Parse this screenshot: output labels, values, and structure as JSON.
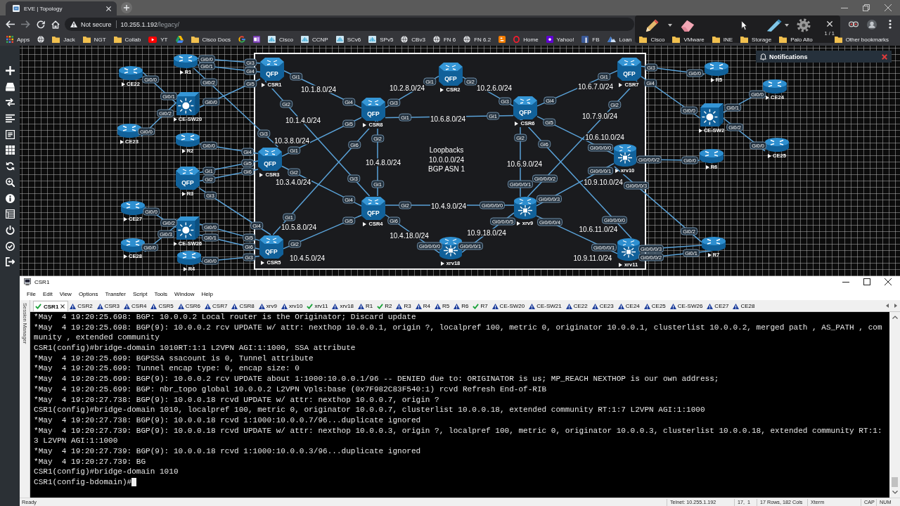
{
  "browser": {
    "tabs": [
      {
        "title": "EVE | Topology",
        "selected": true
      }
    ],
    "address": {
      "security": "Not secure",
      "host": "10.255.1.192",
      "path": "/legacy/"
    },
    "bookmarks": [
      {
        "kind": "apps",
        "label": "Apps"
      },
      {
        "kind": "globe"
      },
      {
        "kind": "folder",
        "label": "Jack"
      },
      {
        "kind": "folder",
        "label": "NGT"
      },
      {
        "kind": "folder",
        "label": "Collab"
      },
      {
        "kind": "video",
        "label": "YT"
      },
      {
        "kind": "drive"
      },
      {
        "kind": "folder",
        "label": "Cisco Docs"
      },
      {
        "kind": "ring"
      },
      {
        "kind": "note"
      },
      {
        "kind": "bars",
        "label": "Cisco"
      },
      {
        "kind": "bars",
        "label": "CCNP"
      },
      {
        "kind": "bars",
        "label": "SCv6"
      },
      {
        "kind": "bars",
        "label": "SPv5"
      },
      {
        "kind": "globe",
        "label": "CBv3"
      },
      {
        "kind": "globe",
        "label": "FN 6"
      },
      {
        "kind": "globe",
        "label": "FN 6.2"
      },
      {
        "kind": "blog"
      },
      {
        "kind": "oval",
        "label": "Home"
      },
      {
        "kind": "square_p",
        "label": "Yahoo!"
      },
      {
        "kind": "square_b",
        "label": "FB"
      },
      {
        "kind": "mountain",
        "label": "Loan"
      },
      {
        "kind": "folder",
        "label": "Cisco"
      },
      {
        "kind": "folder",
        "label": "VMware"
      },
      {
        "kind": "folder",
        "label": "INE"
      },
      {
        "kind": "folder",
        "label": "Storage"
      },
      {
        "kind": "folder",
        "label": "Palo Alto"
      }
    ],
    "other_bookmarks": "Other bookmarks",
    "annotation_toolbar": {
      "page": "1 / 1"
    }
  },
  "topology": {
    "nodes": [
      {
        "name": "CE22",
        "kind": "router",
        "running": true
      },
      {
        "name": "R1",
        "kind": "router",
        "running": true
      },
      {
        "name": "CE-SW20",
        "kind": "switch",
        "running": true
      },
      {
        "name": "CE23",
        "kind": "router",
        "running": true
      },
      {
        "name": "R2",
        "kind": "router",
        "running": true
      },
      {
        "name": "R3",
        "kind": "qfp",
        "badge": "QFP",
        "running": true
      },
      {
        "name": "CE27",
        "kind": "router",
        "running": true
      },
      {
        "name": "CE-SW26",
        "kind": "switch",
        "running": true
      },
      {
        "name": "CE28",
        "kind": "router",
        "running": true
      },
      {
        "name": "R4",
        "kind": "router",
        "running": true
      },
      {
        "name": "CSR1",
        "kind": "qfp",
        "badge": "QFP",
        "running": true
      },
      {
        "name": "CSR2",
        "kind": "qfp",
        "badge": "QFP",
        "running": true
      },
      {
        "name": "CSR8",
        "kind": "qfp",
        "badge": "QFP",
        "running": true
      },
      {
        "name": "CSR6",
        "kind": "qfp",
        "badge": "QFP",
        "running": true
      },
      {
        "name": "CSR7",
        "kind": "qfp",
        "badge": "QFP",
        "running": true
      },
      {
        "name": "CSR3",
        "kind": "qfp",
        "badge": "QFP",
        "running": true
      },
      {
        "name": "xrv10",
        "kind": "xrv",
        "running": true
      },
      {
        "name": "CSR4",
        "kind": "qfp",
        "badge": "QFP",
        "running": true
      },
      {
        "name": "xrv9",
        "kind": "xrv",
        "running": true
      },
      {
        "name": "CSR5",
        "kind": "qfp",
        "badge": "QFP",
        "running": true
      },
      {
        "name": "xrv18",
        "kind": "xrv",
        "running": true
      },
      {
        "name": "xrv11",
        "kind": "xrv",
        "running": true
      },
      {
        "name": "R5",
        "kind": "router",
        "running": true
      },
      {
        "name": "CE-SW2",
        "kind": "switch",
        "running": true
      },
      {
        "name": "CE24",
        "kind": "router",
        "running": true
      },
      {
        "name": "R6",
        "kind": "router",
        "running": true
      },
      {
        "name": "CE25",
        "kind": "router",
        "running": true
      },
      {
        "name": "R7",
        "kind": "router",
        "running": true
      }
    ],
    "links": [
      {
        "a": "Gi0/0",
        "b": "Gi0/1"
      },
      {
        "a": "Gi0/0",
        "b": "Gi0/2"
      },
      {
        "a": "Gi0/0",
        "b": "Gi0/2"
      },
      {
        "a": "Gi0/0",
        "b": "Gi0/3"
      },
      {
        "a": "Gi0/0",
        "b": "Gi3"
      },
      {
        "a": "Gi0/1",
        "b": "Gi4"
      },
      {
        "a": "Gi0/2",
        "b": "Gi3"
      },
      {
        "a": "Gi0/0",
        "b": "Gi5"
      },
      {
        "a": "Gi0/0",
        "b": "Gi4"
      },
      {
        "a": "Gi1",
        "b": "Gi5"
      },
      {
        "a": "Gi2",
        "b": "Gi6"
      },
      {
        "a": "Gi3",
        "b": "Gi4"
      },
      {
        "a": "Gi0/0",
        "b": "Gi5"
      },
      {
        "a": "Gi0/1",
        "b": "Gi6"
      },
      {
        "a": "Gi0/0",
        "b": "Gi3"
      },
      {
        "a": "Gi1",
        "b": "Gi4",
        "subnet": "10.1.8.0/24"
      },
      {
        "a": "Gi2",
        "b": "Gi3",
        "subnet": "10.1.4.0/24"
      },
      {
        "a": "Gi3",
        "b": "Gi1",
        "subnet": "10.2.8.0/24"
      },
      {
        "a": "Gi1",
        "b": "Gi5",
        "subnet": "10.3.8.0/24"
      },
      {
        "a": "Gi2",
        "b": "Gi4",
        "subnet": "10.3.4.0/24"
      },
      {
        "a": "Gi6",
        "b": "Gi1",
        "subnet": "10.5.8.0/24"
      },
      {
        "a": "Gi2",
        "b": "Gi5",
        "subnet": "10.4.5.0/24"
      },
      {
        "a": "Gi2",
        "b": "Gi3",
        "subnet": "10.2.6.0/24"
      },
      {
        "a": "Gi1",
        "b": "Gi1",
        "subnet": "10.6.8.0/24"
      },
      {
        "a": "Gi2",
        "b": "Gi1",
        "subnet": "10.4.8.0/24"
      },
      {
        "a": "Gi2",
        "b": "Gi0/0/0/0",
        "subnet": "10.4.9.0/24"
      },
      {
        "a": "Gi6",
        "b": "Gi0/0/0/0",
        "subnet": "10.4.18.0/24"
      },
      {
        "a": "Gi4",
        "b": "Gi1",
        "subnet": "10.6.7.0/24"
      },
      {
        "a": "Gi2",
        "b": "Gi0/0/0/1",
        "subnet": "10.6.9.0/24"
      },
      {
        "a": "Gi2",
        "b": "Gi0/0/0/2",
        "subnet": "10.7.9.0/24"
      },
      {
        "a": "Gi5",
        "b": "Gi0/0/0/0",
        "subnet": "10.6.10.0/24"
      },
      {
        "a": "Gi0/0/0/3",
        "b": "Gi0/0/0/1",
        "subnet": "10.9.10.0/24"
      },
      {
        "a": "Gi0/0/0/5",
        "b": "Gi0/0/0/1",
        "subnet": "10.9.18.0/24"
      },
      {
        "a": "Gi6",
        "b": "Gi0/0/0/0",
        "subnet": "10.6.11.0/24"
      },
      {
        "a": "Gi0/0/0/4",
        "b": "Gi0/0/0/1",
        "subnet": "10.9.11.0/24"
      },
      {
        "a": "Gi3",
        "b": "Gi0/0"
      },
      {
        "a": "Gi4",
        "b": "Gi0/0"
      },
      {
        "a": "Gi0/1",
        "b": "Gi0/0"
      },
      {
        "a": "Gi0/2",
        "b": "Gi0/0"
      },
      {
        "a": "Gi0/0/0/2",
        "b": "Gi0/0"
      },
      {
        "a": "Gi0/0/0/3",
        "b": "Gi0/2"
      },
      {
        "a": "Gi0/0/0/3"
      },
      {
        "a": "Gi0/0/0/2",
        "b": "Gi0/1"
      }
    ],
    "note": "Loopbacks\n10.0.0.0/24\nBGP ASN 1",
    "notifications": {
      "title": "Notifications"
    }
  },
  "terminal": {
    "title": "CSR1",
    "menu": [
      "File",
      "Edit",
      "View",
      "Options",
      "Transfer",
      "Script",
      "Tools",
      "Window",
      "Help"
    ],
    "session_manager": "Session Manager",
    "tabs": [
      {
        "label": "CSR1",
        "connected": true,
        "selected": true
      },
      {
        "label": "CSR2",
        "connected": false,
        "selected": false
      },
      {
        "label": "CSR3",
        "connected": false,
        "selected": false
      },
      {
        "label": "CSR4",
        "connected": false,
        "selected": false
      },
      {
        "label": "CSR5",
        "connected": false,
        "selected": false
      },
      {
        "label": "CSR6",
        "connected": false,
        "selected": false
      },
      {
        "label": "CSR7",
        "connected": false,
        "selected": false
      },
      {
        "label": "CSR8",
        "connected": false,
        "selected": false
      },
      {
        "label": "xrv9",
        "connected": false,
        "selected": false
      },
      {
        "label": "xrv10",
        "connected": false,
        "selected": false
      },
      {
        "label": "xrv11",
        "connected": true,
        "selected": false
      },
      {
        "label": "xrv18",
        "connected": false,
        "selected": false
      },
      {
        "label": "R1",
        "connected": false,
        "selected": false
      },
      {
        "label": "R2",
        "connected": true,
        "selected": false
      },
      {
        "label": "R3",
        "connected": false,
        "selected": false
      },
      {
        "label": "R4",
        "connected": false,
        "selected": false
      },
      {
        "label": "R5",
        "connected": false,
        "selected": false
      },
      {
        "label": "R6",
        "connected": false,
        "selected": false
      },
      {
        "label": "R7",
        "connected": true,
        "selected": false
      },
      {
        "label": "CE-SW20",
        "connected": false,
        "selected": false
      },
      {
        "label": "CE-SW21",
        "connected": false,
        "selected": false
      },
      {
        "label": "CE22",
        "connected": false,
        "selected": false
      },
      {
        "label": "CE23",
        "connected": false,
        "selected": false
      },
      {
        "label": "CE24",
        "connected": false,
        "selected": false
      },
      {
        "label": "CE25",
        "connected": false,
        "selected": false
      },
      {
        "label": "CE-SW26",
        "connected": false,
        "selected": false
      },
      {
        "label": "CE27",
        "connected": false,
        "selected": false
      },
      {
        "label": "CE28",
        "connected": false,
        "selected": false
      }
    ],
    "lines": [
      "*May  4 19:20:25.698: BGP: 10.0.0.2 Local router is the Originator; Discard update",
      "*May  4 19:20:25.698: BGP(9): 10.0.0.2 rcv UPDATE w/ attr: nexthop 10.0.0.1, origin ?, localpref 100, metric 0, originator 10.0.0.1, clusterlist 10.0.0.2, merged path , AS_PATH , com",
      "munity , extended community",
      "CSR1(config)#bridge-domain 1010RT:1:1 L2VPN AGI:1:1000, SSA attribute",
      "*May  4 19:20:25.699: BGPSSA ssacount is 0, Tunnel attribute",
      "*May  4 19:20:25.699: Tunnel encap type: 0, encap size: 0",
      "*May  4 19:20:25.699: BGP(9): 10.0.0.2 rcv UPDATE about 1:1000:10.0.0.1/96 -- DENIED due to: ORIGINATOR is us; MP_REACH NEXTHOP is our own address;",
      "*May  4 19:20:25.699: BGP: nbr_topo global 10.0.0.2 L2VPN Vpls:base (0x7F982C83F540:1) rcvd Refresh End-of-RIB",
      "*May  4 19:20:27.738: BGP(9): 10.0.0.18 rcvd UPDATE w/ attr: nexthop 10.0.0.7, origin ?",
      "CSR1(config)#bridge-domain 1010, localpref 100, metric 0, originator 10.0.0.7, clusterlist 10.0.0.18, extended community RT:1:7 L2VPN AGI:1:1000",
      "*May  4 19:20:27.738: BGP(9): 10.0.0.18 rcvd 1:1000:10.0.0.7/96...duplicate ignored",
      "*May  4 19:20:27.739: BGP(9): 10.0.0.18 rcvd UPDATE w/ attr: nexthop 10.0.0.3, origin ?, localpref 100, metric 0, originator 10.0.0.3, clusterlist 10.0.0.18, extended community RT:1:",
      "3 L2VPN AGI:1:1000",
      "*May  4 19:20:27.739: BGP(9): 10.0.0.18 rcvd 1:1000:10.0.0.3/96...duplicate ignored",
      "*May  4 19:20:27.739: BG",
      "CSR1(config)#bridge-domain 1010",
      "CSR1(config-bdomain)#"
    ],
    "cursor": true,
    "status_bar": {
      "state": "Ready",
      "connection": "Telnet: 10.255.1.192",
      "position": "17,  1",
      "size": "17 Rows, 182 Cols",
      "emulation": "Xterm",
      "caps": "CAP",
      "num": "NUM"
    }
  }
}
